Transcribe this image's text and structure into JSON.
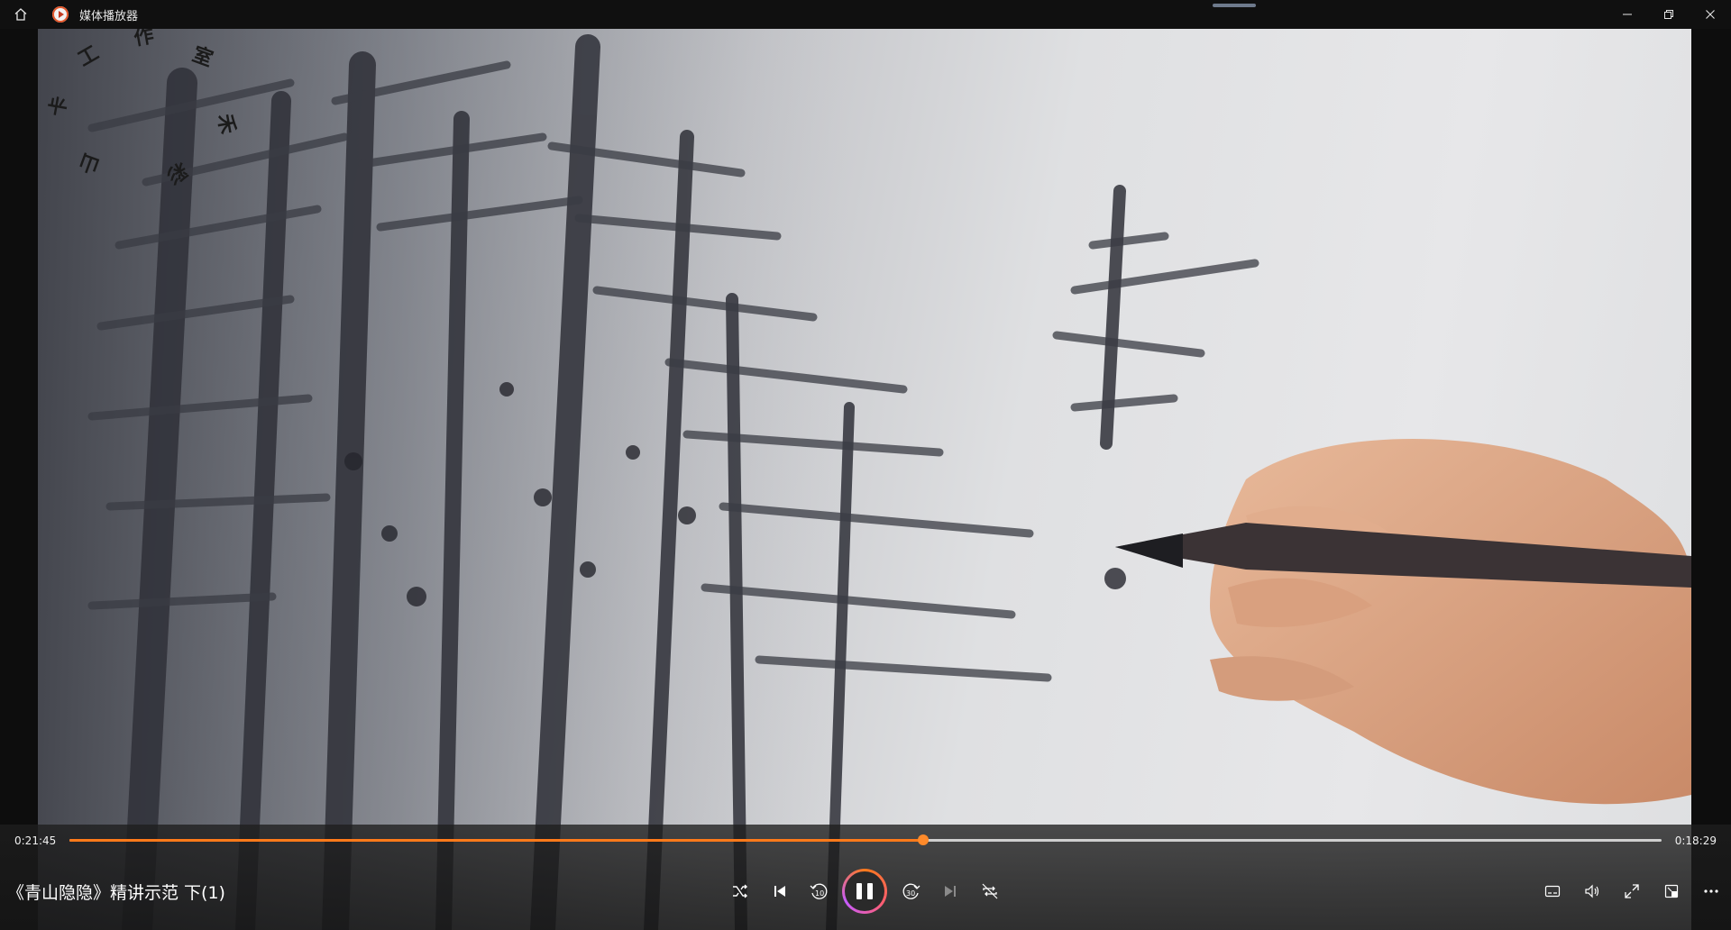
{
  "window": {
    "title": "媒体播放器",
    "home_icon": "home-icon",
    "controls": [
      "minimize-icon",
      "restore-icon",
      "close-icon"
    ]
  },
  "watermark": {
    "chars": [
      "工",
      "作",
      "室",
      "卡",
      "禾",
      "山",
      "彩"
    ]
  },
  "player": {
    "elapsed": "0:21:45",
    "remaining": "0:18:29",
    "progress": 0.536,
    "media_title": "《青山隐隐》精讲示范 下(1)",
    "buttons": {
      "shuffle": "shuffle-icon",
      "previous": "previous-icon",
      "skip_back": "10",
      "play_pause": "pause-icon",
      "skip_forward": "30",
      "next": "next-icon",
      "repeat": "repeat-icon",
      "subtitles": "subtitles-icon",
      "volume": "volume-icon",
      "fullscreen": "fullscreen-icon",
      "mini_player": "mini-player-icon",
      "more": "more-icon"
    },
    "accent_color": "#ff7a1a"
  }
}
